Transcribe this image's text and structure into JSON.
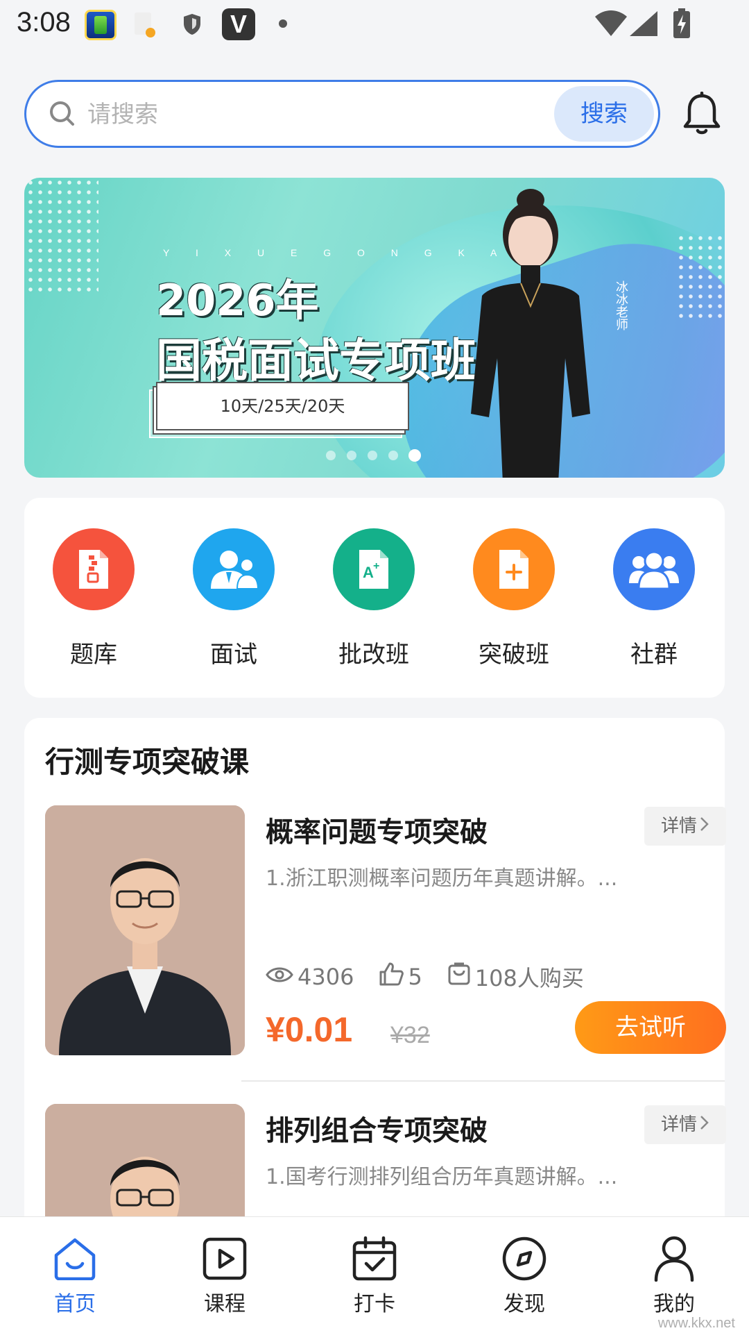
{
  "status_bar": {
    "time": "3:08"
  },
  "search": {
    "placeholder": "请搜索",
    "button_label": "搜索"
  },
  "banner": {
    "subtitle": "Y I X U E G O N G K A O",
    "title_line1": "2026年",
    "title_line2": "国税面试专项班",
    "tag": "10天/25天/20天",
    "teacher_name": "冰冰老师",
    "slide_count": 5,
    "active_slide": 5
  },
  "menu": {
    "items": [
      {
        "label": "题库",
        "icon": "file-zip-icon",
        "color": "#f5533d"
      },
      {
        "label": "面试",
        "icon": "interview-people-icon",
        "color": "#1fa6ee"
      },
      {
        "label": "批改班",
        "icon": "grade-doc-icon",
        "color": "#14b08a"
      },
      {
        "label": "突破班",
        "icon": "add-doc-icon",
        "color": "#ff8a1e"
      },
      {
        "label": "社群",
        "icon": "group-icon",
        "color": "#3a7df0"
      }
    ]
  },
  "section": {
    "title": "行测专项突破课"
  },
  "courses": [
    {
      "title": "概率问题专项突破",
      "detail_label": "详情",
      "description": "1.浙江职测概率问题历年真题讲解。...",
      "views": "4306",
      "likes": "5",
      "buyers": "108人购买",
      "price": "¥0.01",
      "original_price": "¥32",
      "trial_label": "去试听"
    },
    {
      "title": "排列组合专项突破",
      "detail_label": "详情",
      "description": "1.国考行测排列组合历年真题讲解。..."
    }
  ],
  "bottom_nav": {
    "items": [
      {
        "label": "首页",
        "icon": "home-icon",
        "active": true
      },
      {
        "label": "课程",
        "icon": "play-icon",
        "active": false
      },
      {
        "label": "打卡",
        "icon": "calendar-check-icon",
        "active": false
      },
      {
        "label": "发现",
        "icon": "compass-icon",
        "active": false
      },
      {
        "label": "我的",
        "icon": "user-icon",
        "active": false
      }
    ]
  },
  "watermark": "www.kkx.net",
  "colors": {
    "accent": "#2a6ee8",
    "price": "#f4682b",
    "trial_button": "#ff7f1c"
  }
}
